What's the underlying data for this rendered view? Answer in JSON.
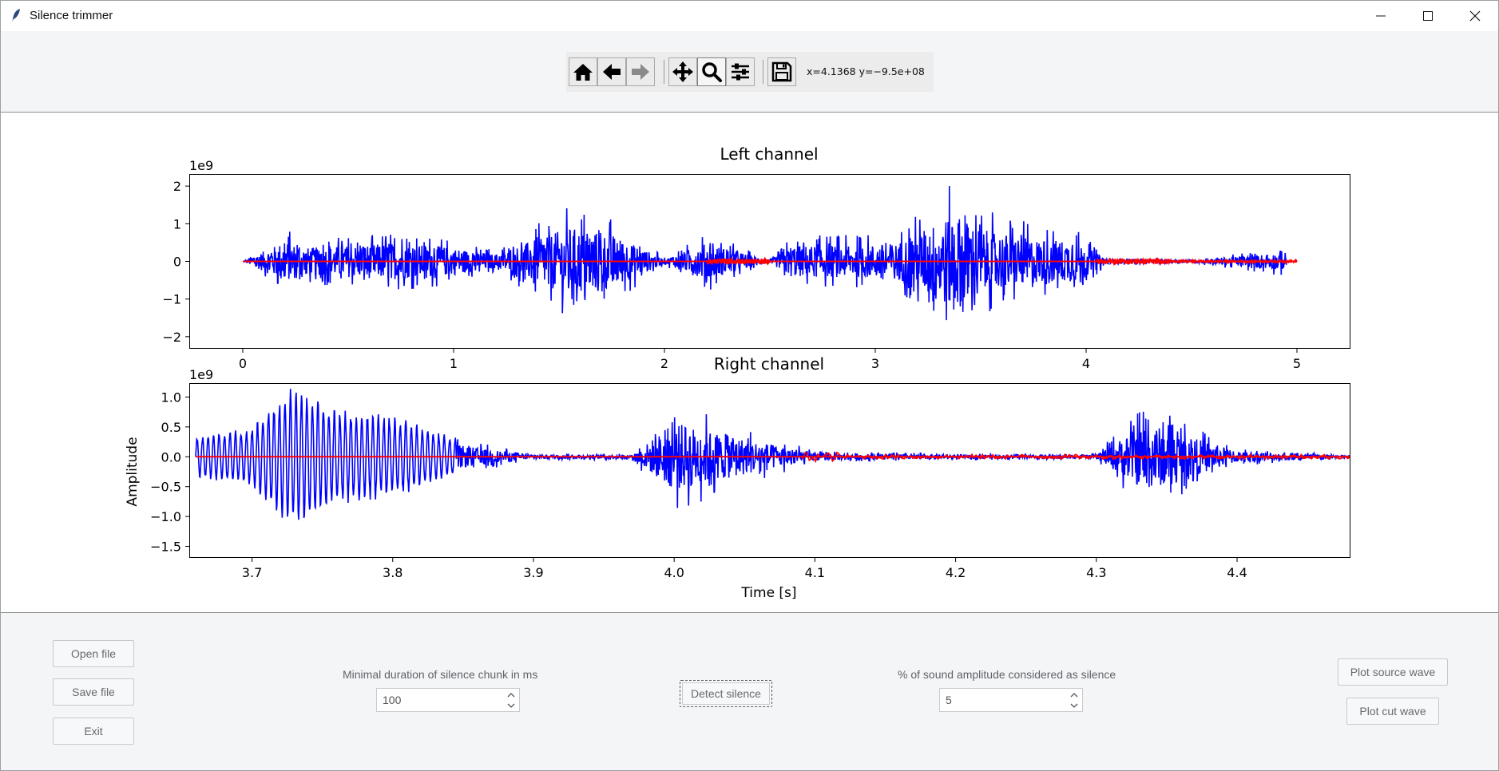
{
  "window": {
    "title": "Silence trimmer"
  },
  "toolbar": {
    "coords": "x=4.1368 y=−9.5e+08"
  },
  "left_chart": {
    "title": "Left channel",
    "yexp": "1e9",
    "yticks": [
      "2",
      "1",
      "0",
      "−1",
      "−2"
    ],
    "xticks": [
      "0",
      "1",
      "2",
      "3",
      "4",
      "5"
    ]
  },
  "right_chart": {
    "title": "Right channel",
    "yexp": "1e9",
    "ylabel": "Amplitude",
    "xlabel": "Time [s]",
    "yticks": [
      "1.0",
      "0.5",
      "0.0",
      "−0.5",
      "−1.0",
      "−1.5"
    ],
    "xticks": [
      "3.7",
      "3.8",
      "3.9",
      "4.0",
      "4.1",
      "4.2",
      "4.3",
      "4.4"
    ]
  },
  "chart_data": [
    {
      "type": "line",
      "title": "Left channel",
      "xlabel": "",
      "ylabel": "",
      "y_scale_note": "1e9",
      "xlim": [
        -0.25,
        5.25
      ],
      "ylim": [
        -2.3,
        2.3
      ],
      "series": [
        {
          "color": "#0000ff",
          "x": [
            0,
            0.2,
            0.3,
            0.5,
            0.7,
            0.9,
            1.0,
            1.2,
            1.4,
            1.55,
            1.75,
            2.0,
            2.2,
            2.5,
            2.6,
            2.9,
            3.1,
            3.38,
            3.5,
            3.75,
            3.95,
            4.1,
            4.5,
            4.95
          ],
          "y": [
            0,
            0.9,
            0.6,
            0.7,
            0.8,
            0.7,
            0.6,
            0.3,
            1.0,
            1.5,
            1.2,
            0.1,
            0.8,
            0.05,
            0.7,
            0.7,
            0.8,
            2.15,
            1.4,
            1.0,
            0.9,
            0.1,
            0.05,
            0.4
          ]
        },
        {
          "color": "#ff0000",
          "x": [
            0,
            5.0
          ],
          "y": [
            0,
            0
          ]
        }
      ]
    },
    {
      "type": "line",
      "title": "Right channel",
      "xlabel": "Time [s]",
      "ylabel": "Amplitude",
      "y_scale_note": "1e9",
      "xlim": [
        3.656,
        4.48
      ],
      "ylim": [
        -1.68,
        1.22
      ],
      "series": [
        {
          "color": "#0000ff",
          "x": [
            3.66,
            3.7,
            3.72,
            3.73,
            3.76,
            3.8,
            3.84,
            3.9,
            3.97,
            4.0,
            4.05,
            4.1,
            4.2,
            4.3,
            4.335,
            4.4,
            4.48
          ],
          "y": [
            0.35,
            0.5,
            1.0,
            1.2,
            0.8,
            0.7,
            0.35,
            0.05,
            0.05,
            0.95,
            0.5,
            0.1,
            0.05,
            0.05,
            0.95,
            0.15,
            0.03
          ]
        },
        {
          "color": "#ff0000",
          "x": [
            3.66,
            4.48
          ],
          "y": [
            0,
            0
          ]
        }
      ]
    }
  ],
  "controls": {
    "open_file": "Open file",
    "save_file": "Save file",
    "exit": "Exit",
    "min_duration_label": "Minimal duration of silence chunk in ms",
    "min_duration_value": "100",
    "detect_silence": "Detect silence",
    "amplitude_label": "% of sound amplitude considered as silence",
    "amplitude_value": "5",
    "plot_source": "Plot source wave",
    "plot_cut": "Plot cut wave"
  }
}
